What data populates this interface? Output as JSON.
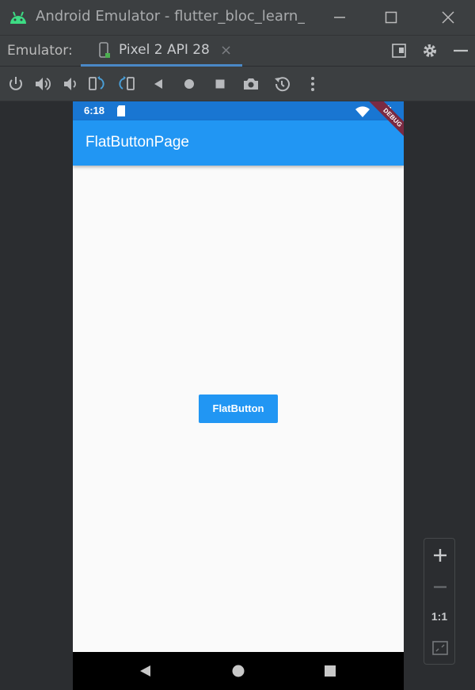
{
  "window": {
    "title": "Android Emulator - flutter_bloc_learn_m",
    "colors": {
      "chrome": "#3c3f41",
      "background": "#2b2d30",
      "accent": "#4a88c7"
    }
  },
  "tabbar": {
    "label": "Emulator:",
    "device_tab": "Pixel 2 API 28",
    "close_glyph": "×"
  },
  "toolbar": {
    "icons": [
      "power-icon",
      "volume-up-icon",
      "volume-down-icon",
      "rotate-left-icon",
      "rotate-right-icon",
      "back-icon",
      "home-icon",
      "overview-icon",
      "screenshot-icon",
      "snapshot-icon",
      "more-icon"
    ]
  },
  "phone": {
    "status": {
      "time": "6:18"
    },
    "appbar": {
      "title": "FlatButtonPage",
      "color": "#2196f3",
      "status_color": "#1976d2"
    },
    "debug_banner": "DEBUG",
    "button": {
      "label": "FlatButton"
    },
    "background": "#fafafa"
  },
  "zoom": {
    "actual_size_label": "1:1"
  }
}
